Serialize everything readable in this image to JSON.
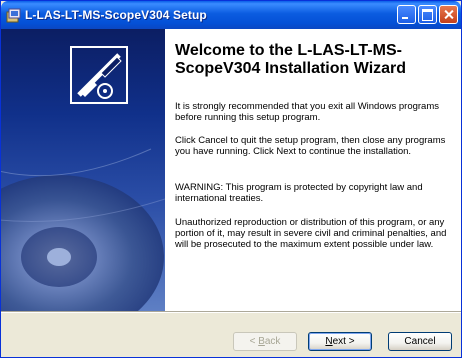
{
  "window": {
    "title": "L-LAS-LT-MS-ScopeV304 Setup",
    "controls": [
      "minimize-icon",
      "maximize-icon",
      "close-icon"
    ]
  },
  "wizard": {
    "heading": "Welcome to the L-LAS-LT-MS-ScopeV304 Installation Wizard",
    "paragraphs": [
      "It is strongly recommended that you exit all Windows programs before running this setup program.",
      "Click Cancel to quit the setup program, then close any programs you have running.  Click Next to continue the installation.",
      "WARNING: This program is protected by copyright law and international treaties.",
      "Unauthorized reproduction or distribution of this program, or any portion of it, may result in severe civil and criminal penalties, and will be prosecuted to the maximum extent possible under law."
    ]
  },
  "buttons": {
    "back": {
      "pre": "< ",
      "key": "B",
      "post": "ack"
    },
    "next": {
      "key": "N",
      "post": "ext >"
    },
    "cancel": "Cancel"
  },
  "colors": {
    "titlebar": "#0A5FE8",
    "panel_dark": "#0C1E63",
    "panel_light": "#5E7FC4",
    "window_bg": "#ECE9D8"
  }
}
